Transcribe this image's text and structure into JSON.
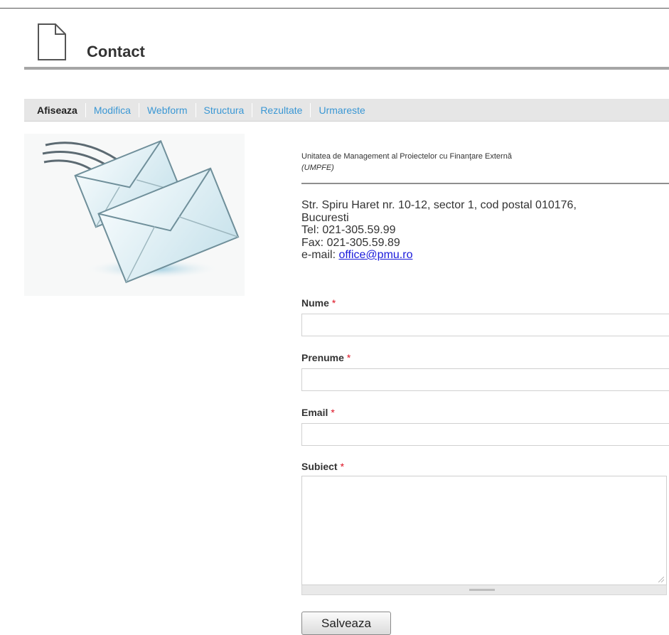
{
  "page": {
    "title": "Contact"
  },
  "tabs": [
    {
      "label": "Afiseaza",
      "active": true
    },
    {
      "label": "Modifica",
      "active": false
    },
    {
      "label": "Webform",
      "active": false
    },
    {
      "label": "Structura",
      "active": false
    },
    {
      "label": "Rezultate",
      "active": false
    },
    {
      "label": "Urmareste",
      "active": false
    }
  ],
  "organization": {
    "name": "Unitatea de Management al Proiectelor cu Finanţare Externă",
    "abbr": "(UMPFE)"
  },
  "address": {
    "street": "Str. Spiru Haret nr. 10-12, sector 1, cod postal 010176,",
    "city": "Bucuresti",
    "tel": "Tel: 021-305.59.99",
    "fax": "Fax: 021-305.59.89",
    "email_label": "e-mail:",
    "email": "office@pmu.ro"
  },
  "form": {
    "fields": [
      {
        "label": "Nume",
        "required_mark": "*",
        "value": ""
      },
      {
        "label": "Prenume",
        "required_mark": "*",
        "value": ""
      },
      {
        "label": "Email",
        "required_mark": "*",
        "value": ""
      },
      {
        "label": "Subiect",
        "required_mark": "*",
        "value": ""
      }
    ],
    "submit_label": "Salveaza"
  },
  "icons": {
    "page": "document-icon",
    "illustration": "envelopes-icon"
  },
  "colors": {
    "tab_link": "#3a97d4",
    "email_link": "#1a1adb",
    "required": "#dd1122",
    "tab_bar": "#e6e6e6"
  }
}
